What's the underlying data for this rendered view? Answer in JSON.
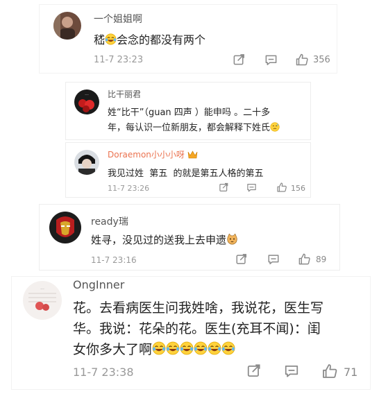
{
  "comments": [
    {
      "username": "一个姐姐啊",
      "text_before_emoji": "嵇",
      "text_after_emoji": "会念的都没有两个",
      "time": "11-7 23:23",
      "likes": "356"
    },
    {
      "username": "比干丽君",
      "text_line1": "姓“比干”（guan 四声 ）能申吗 。二十多",
      "text_line2": "年，每认识一位新朋友，都会解释下姓氏"
    },
    {
      "username": "Doraemon小小小呀",
      "text": "我见过姓  第五  的就是第五人格的第五",
      "time": "11-7 23:26",
      "likes": "156"
    },
    {
      "username": "ready瑞",
      "text": "姓寻，没见过的送我上去申遗",
      "time": "11-7 23:16",
      "likes": "89"
    },
    {
      "username": "OngInner",
      "text_line1": "花。去看病医生问我姓啥，我说花，医生写",
      "text_line2": "华。我说：花朵的花。医生(充耳不闻)：闺",
      "text_line3": "女你多大了啊",
      "time": "11-7 23:38",
      "likes": "71"
    }
  ],
  "icons": {
    "share": "share-icon",
    "comment": "comment-icon",
    "like": "thumbs-up-icon",
    "laugh_emoji": "laugh-cry-emoji-icon",
    "sweat_emoji": "sweat-emoji-icon",
    "cat_emoji": "cat-emoji-icon",
    "vip_badge": "vip-badge-icon"
  },
  "colors": {
    "username_link": "#eb7350",
    "time": "#999999",
    "text": "#222222"
  }
}
